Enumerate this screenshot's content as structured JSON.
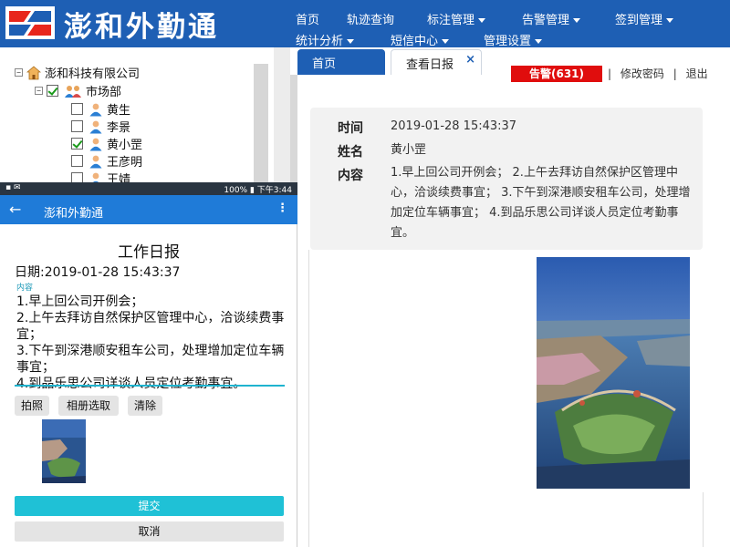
{
  "app": {
    "name": "澎和外勤通"
  },
  "nav": {
    "row1": [
      {
        "label": "首页",
        "dropdown": false
      },
      {
        "label": "轨迹查询",
        "dropdown": false
      },
      {
        "label": "标注管理",
        "dropdown": true
      },
      {
        "label": "告警管理",
        "dropdown": true
      },
      {
        "label": "签到管理",
        "dropdown": true
      }
    ],
    "row2": [
      {
        "label": "统计分析",
        "dropdown": true
      },
      {
        "label": "短信中心",
        "dropdown": true
      },
      {
        "label": "管理设置",
        "dropdown": true
      }
    ]
  },
  "tree": {
    "company": "澎和科技有限公司",
    "department": "市场部",
    "members": [
      {
        "name": "黄生",
        "checked": false
      },
      {
        "name": "李景",
        "checked": false
      },
      {
        "name": "黄小罡",
        "checked": true
      },
      {
        "name": "王彦明",
        "checked": false
      },
      {
        "name": "王婧",
        "checked": false
      }
    ]
  },
  "tabs": {
    "home": "首页",
    "active": "查看日报",
    "close": "×"
  },
  "alarm": {
    "label": "告警(631)"
  },
  "top_links": {
    "change_password": "修改密码",
    "logout": "退出",
    "sep": "|"
  },
  "report_detail": {
    "time_label": "时间",
    "time_value": "2019-01-28 15:43:37",
    "name_label": "姓名",
    "name_value": "黄小罡",
    "content_label": "内容",
    "content_value": "1.早上回公司开例会； 2.上午去拜访自然保护区管理中心，洽谈续费事宜； 3.下午到深港顺安租车公司，处理增加定位车辆事宜； 4.到品乐思公司详谈人员定位考勤事宜。"
  },
  "mobile": {
    "status_left": "▪ ✉",
    "status_right": "100% ▮ 下午3:44",
    "title": "澎和外勤通",
    "back_icon": "←",
    "menu_icon": "⋮",
    "heading": "工作日报",
    "date_line": "日期:2019-01-28 15:43:37",
    "content_label": "内容",
    "content_lines": [
      "1.早上回公司开例会；",
      "2.上午去拜访自然保护区管理中心，洽谈续费事宜；",
      "3.下午到深港顺安租车公司，处理增加定位车辆事宜；",
      "4.到品乐思公司详谈人员定位考勤事宜。"
    ],
    "buttons": {
      "photo": "拍照",
      "album": "相册选取",
      "clear": "清除"
    },
    "submit": "提交",
    "cancel": "取消"
  },
  "colors": {
    "brand_blue": "#1e5fb4",
    "alarm_red": "#e00d0d",
    "submit_cyan": "#1fc1d6",
    "mobile_app_bar": "#1f7bd8"
  }
}
